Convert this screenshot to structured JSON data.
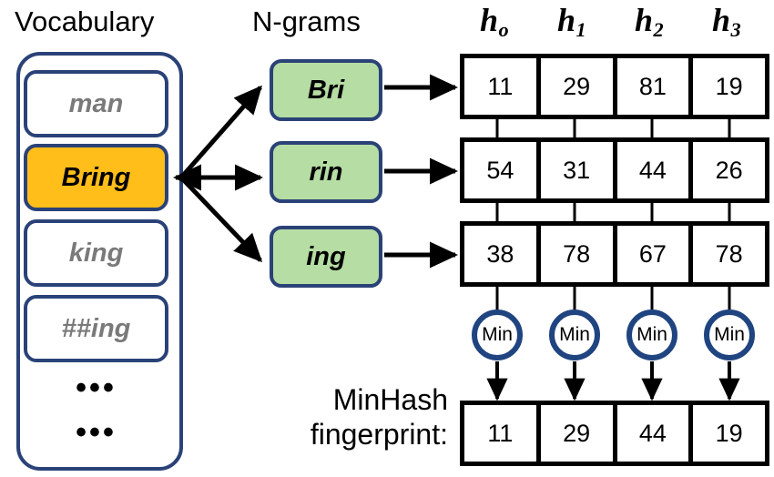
{
  "figure": {
    "type": "diagram",
    "description": "MinHash fingerprint computation from vocabulary token n-grams"
  },
  "columns": {
    "vocabulary_title": "Vocabulary",
    "ngrams_title": "N-grams"
  },
  "vocabulary": {
    "items": [
      {
        "label": "man",
        "selected": false
      },
      {
        "label": "Bring",
        "selected": true
      },
      {
        "label": "king",
        "selected": false
      },
      {
        "label": "##ing",
        "selected": false
      }
    ],
    "ellipsis": [
      {
        "label": "•••"
      },
      {
        "label": "•••"
      }
    ]
  },
  "ngrams": {
    "items": [
      {
        "label": "Bri"
      },
      {
        "label": "rin"
      },
      {
        "label": "ing"
      }
    ]
  },
  "hash_headers": [
    {
      "base": "h",
      "sub": "o"
    },
    {
      "base": "h",
      "sub": "1"
    },
    {
      "base": "h",
      "sub": "2"
    },
    {
      "base": "h",
      "sub": "3"
    }
  ],
  "hash_rows": [
    {
      "ngram": "Bri",
      "values": [
        "11",
        "29",
        "81",
        "19"
      ]
    },
    {
      "ngram": "rin",
      "values": [
        "54",
        "31",
        "44",
        "26"
      ]
    },
    {
      "ngram": "ing",
      "values": [
        "38",
        "78",
        "67",
        "78"
      ]
    }
  ],
  "min_operators": [
    {
      "label": "Min"
    },
    {
      "label": "Min"
    },
    {
      "label": "Min"
    },
    {
      "label": "Min"
    }
  ],
  "fingerprint": {
    "label_line1": "MinHash",
    "label_line2": "fingerprint:",
    "values": [
      "11",
      "29",
      "44",
      "19"
    ]
  },
  "colors": {
    "selected_token": "#ffbe19",
    "ngram_fill": "#b6dda3",
    "outline_blue": "#2a4278",
    "min_circle_blue": "#1f4480",
    "table_black": "#000000",
    "muted_text": "#7a7a7a",
    "background": "#ffffff"
  }
}
